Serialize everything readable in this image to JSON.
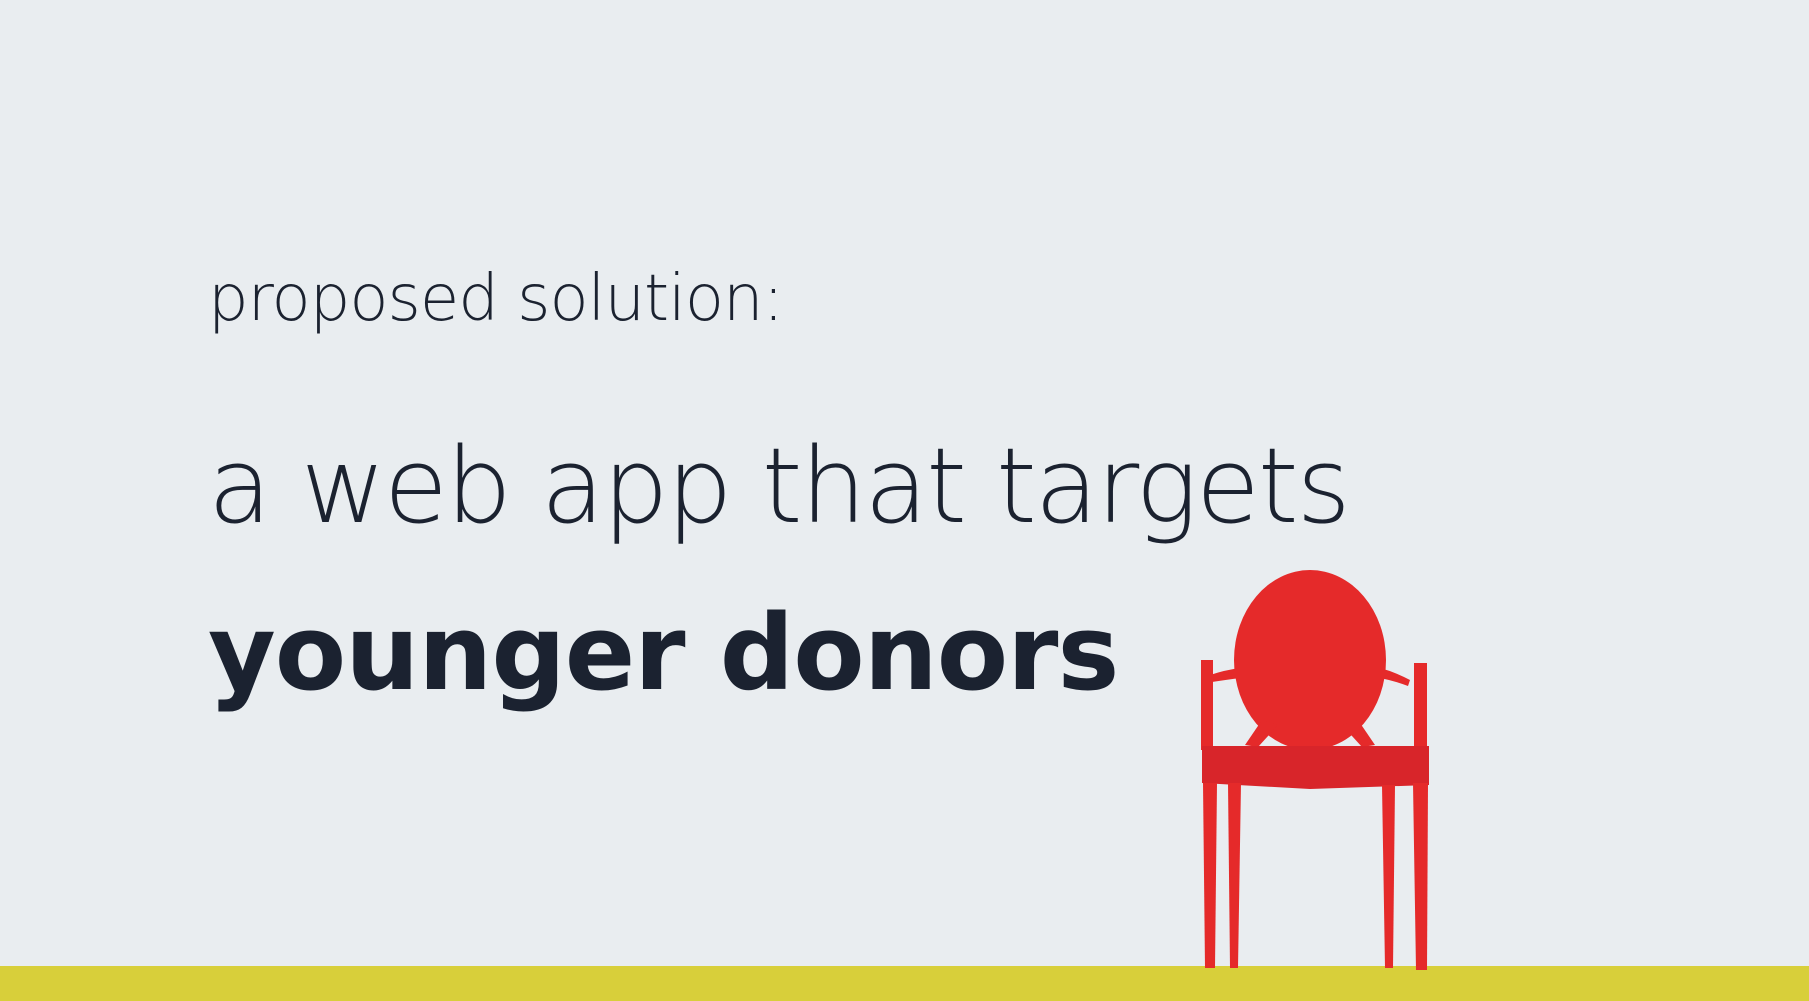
{
  "slide": {
    "heading": "proposed solution:",
    "line1": "a web app that targets",
    "line2": "younger donors"
  },
  "colors": {
    "background": "#e9edf0",
    "text": "#1b2230",
    "chair": "#e52a2a",
    "ground": "#d8cf3a"
  }
}
